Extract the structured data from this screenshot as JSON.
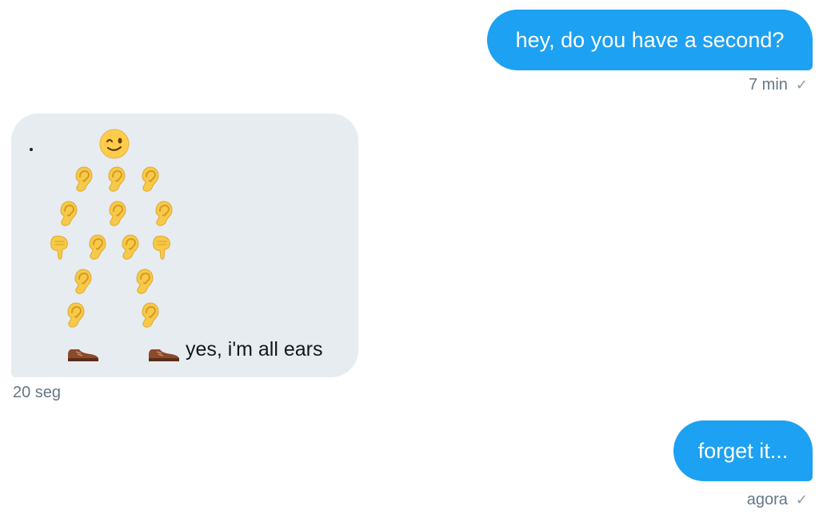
{
  "messages": [
    {
      "direction": "sent",
      "text": "hey, do you have a second?",
      "time": "7 min",
      "status_icon": "checkmark-icon"
    },
    {
      "direction": "received",
      "dot": ".",
      "emoji_art": {
        "head": "winking-face-emoji",
        "body": "ear-emoji",
        "feet": "shoe-emoji"
      },
      "text": "yes, i'm all ears",
      "time": "20 seg"
    },
    {
      "direction": "sent",
      "text": "forget it...",
      "time": "agora",
      "status_icon": "checkmark-icon"
    }
  ],
  "colors": {
    "sent_bubble": "#1da1f2",
    "received_bubble": "#e6ecf0",
    "timestamp": "#657786",
    "ear": "#f7c948"
  }
}
